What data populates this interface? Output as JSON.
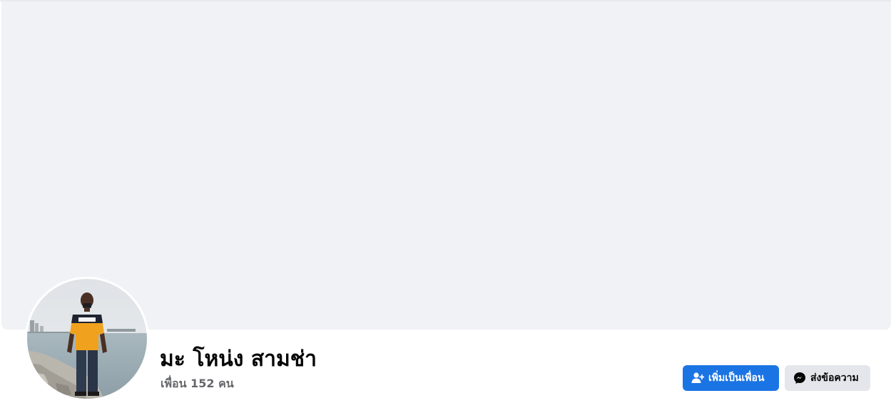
{
  "profile": {
    "name": "มะ โหน่ง สามช่า",
    "friends_text": "เพื่อน 152 คน"
  },
  "actions": {
    "add_friend_label": "เพิ่มเป็นเพื่อน",
    "add_friend_icon": "user-plus-icon",
    "message_label": "ส่งข้อความ",
    "message_icon": "messenger-icon"
  },
  "colors": {
    "cover_background": "#f0f2f5",
    "primary_button": "#1b74e4",
    "secondary_button": "#e4e6eb",
    "secondary_text": "#65676b"
  }
}
